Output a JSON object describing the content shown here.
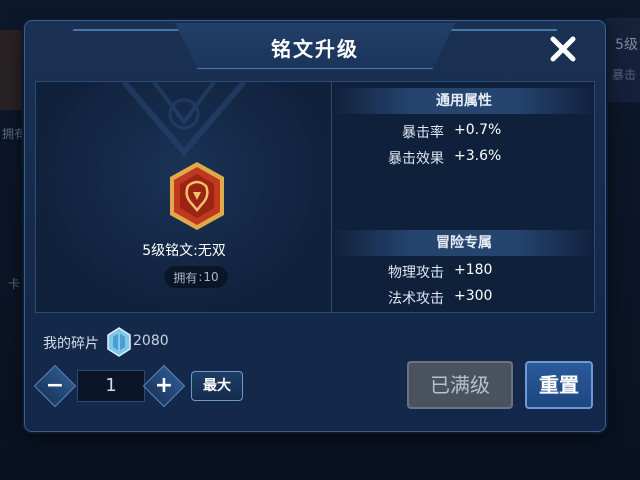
{
  "dialog": {
    "title": "铭文升级",
    "close_icon": "close-icon"
  },
  "rune": {
    "icon": "rune-crest-icon",
    "name": "5级铭文:无双",
    "owned_label": "拥有",
    "owned_sep": ":",
    "owned_count": "10"
  },
  "attributes": {
    "general_title": "通用属性",
    "general": [
      {
        "key": "暴击率",
        "value": "+0.7%"
      },
      {
        "key": "暴击效果",
        "value": "+3.6%"
      }
    ],
    "adventure_title": "冒险专属",
    "adventure": [
      {
        "key": "物理攻击",
        "value": "+180"
      },
      {
        "key": "法术攻击",
        "value": "+300"
      }
    ]
  },
  "fragments": {
    "label": "我的碎片",
    "icon": "fragment-crystal-icon",
    "count": "2080"
  },
  "controls": {
    "minus": "−",
    "plus": "+",
    "quantity": "1",
    "max_label": "最大",
    "maxed_label": "已满级",
    "reset_label": "重置"
  },
  "background": {
    "right_title": "5级",
    "right_sub": "暴击",
    "left_text": "拥有",
    "left_text2": "卡"
  },
  "colors": {
    "accent": "#2a5a9a",
    "disabled": "#4a5260",
    "rune_red": "#c0391f",
    "rune_gold": "#e0a94a"
  }
}
